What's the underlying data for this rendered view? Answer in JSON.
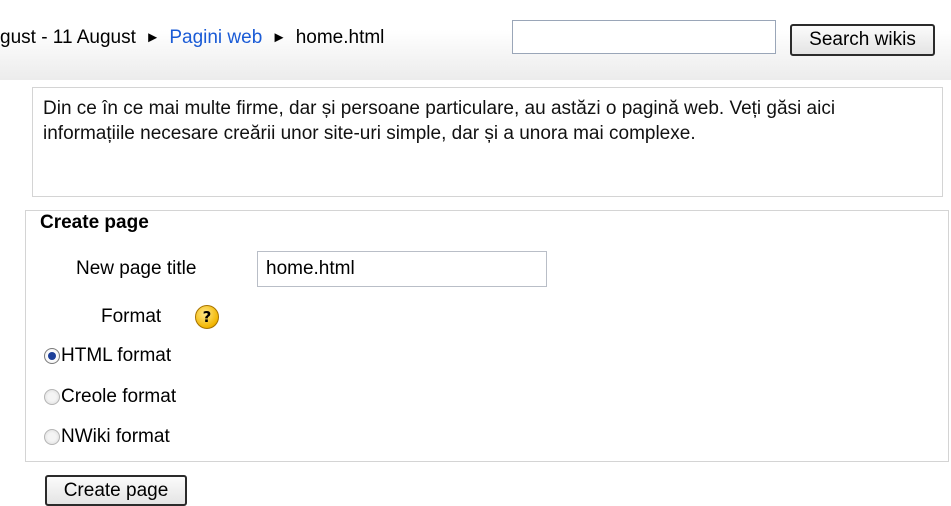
{
  "navbar": {
    "breadcrumb": {
      "date_range": "gust - 11 August",
      "separator": "►",
      "link": "Pagini web",
      "current": "home.html"
    },
    "search": {
      "value": "",
      "placeholder": "",
      "button_label": "Search wikis"
    }
  },
  "intro": {
    "text": "Din ce în ce mai multe firme, dar și persoane particulare, au astăzi o pagină web. Veți găsi aici informațiile necesare creării unor site-uri simple, dar și a unora mai complexe."
  },
  "create_form": {
    "legend": "Create page",
    "title_label": "New page title",
    "title_value": "home.html",
    "format_label": "Format",
    "help_icon_glyph": "?",
    "formats": [
      {
        "label": "HTML format",
        "checked": true
      },
      {
        "label": "Creole format",
        "checked": false
      },
      {
        "label": "NWiki format",
        "checked": false
      }
    ],
    "submit_label": "Create page"
  }
}
